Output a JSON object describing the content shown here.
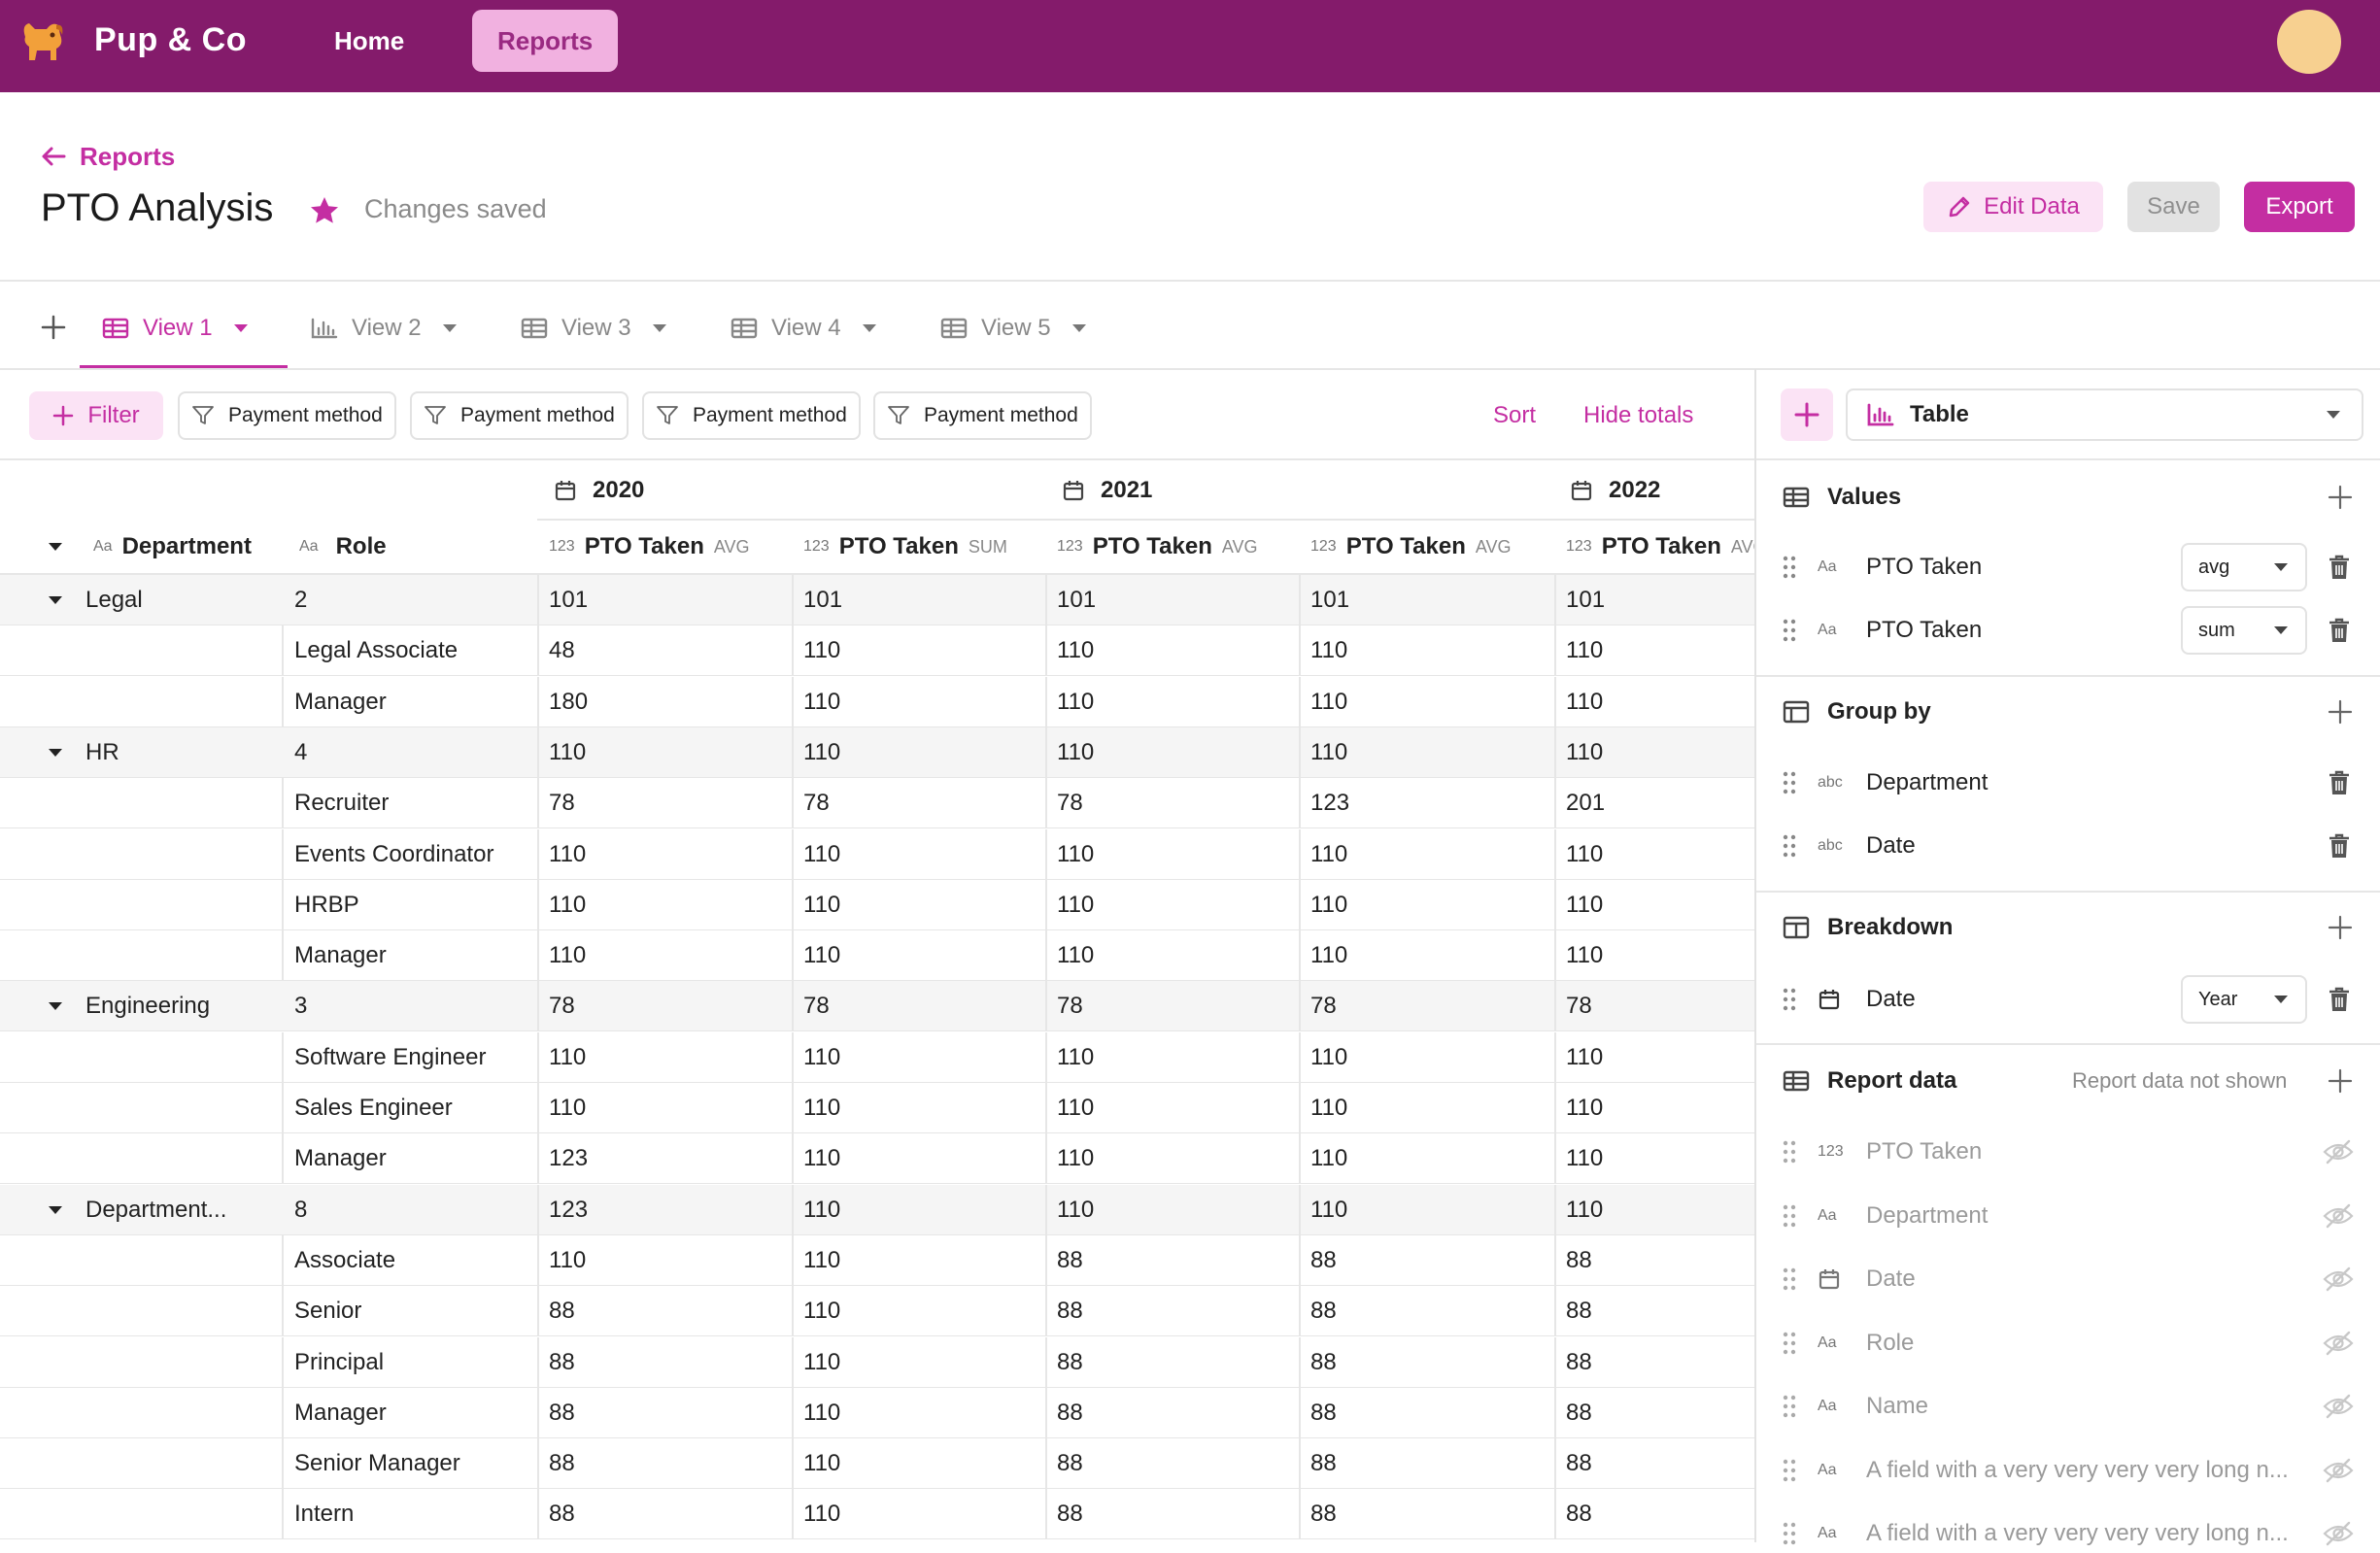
{
  "app": {
    "brand": "Pup & Co",
    "nav": [
      "Home",
      "Reports"
    ],
    "active_nav": "Reports"
  },
  "header": {
    "back_label": "Reports",
    "title": "PTO Analysis",
    "saved_status": "Changes saved",
    "edit_label": "Edit Data",
    "save_label": "Save",
    "export_label": "Export"
  },
  "tabs": [
    {
      "label": "View 1",
      "icon": "table-icon",
      "active": true
    },
    {
      "label": "View 2",
      "icon": "bar-chart-icon",
      "active": false
    },
    {
      "label": "View 3",
      "icon": "table-icon",
      "active": false
    },
    {
      "label": "View 4",
      "icon": "table-icon",
      "active": false
    },
    {
      "label": "View 5",
      "icon": "table-icon",
      "active": false
    }
  ],
  "toolbar": {
    "filter_label": "Filter",
    "chips": [
      "Payment method",
      "Payment method",
      "Payment method",
      "Payment method"
    ],
    "sort_label": "Sort",
    "hide_totals_label": "Hide totals"
  },
  "table": {
    "years": [
      "2020",
      "2021",
      "2022"
    ],
    "row_headers": [
      {
        "type": "Aa",
        "label": "Department"
      },
      {
        "type": "Aa",
        "label": "Role"
      }
    ],
    "value_columns": [
      {
        "type": "123",
        "label": "PTO Taken",
        "agg": "AVG"
      },
      {
        "type": "123",
        "label": "PTO Taken",
        "agg": "SUM"
      },
      {
        "type": "123",
        "label": "PTO Taken",
        "agg": "AVG"
      },
      {
        "type": "123",
        "label": "PTO Taken",
        "agg": "AVG"
      },
      {
        "type": "123",
        "label": "PTO Taken",
        "agg": "AVG"
      }
    ],
    "rows": [
      {
        "group": true,
        "dept": "Legal",
        "role": "2",
        "values": [
          "101",
          "101",
          "101",
          "101",
          "101"
        ]
      },
      {
        "group": false,
        "dept": "",
        "role": "Legal Associate",
        "values": [
          "48",
          "110",
          "110",
          "110",
          "110"
        ]
      },
      {
        "group": false,
        "dept": "",
        "role": "Manager",
        "values": [
          "180",
          "110",
          "110",
          "110",
          "110"
        ]
      },
      {
        "group": true,
        "dept": "HR",
        "role": "4",
        "values": [
          "110",
          "110",
          "110",
          "110",
          "110"
        ]
      },
      {
        "group": false,
        "dept": "",
        "role": "Recruiter",
        "values": [
          "78",
          "78",
          "78",
          "123",
          "201"
        ]
      },
      {
        "group": false,
        "dept": "",
        "role": "Events Coordinator",
        "values": [
          "110",
          "110",
          "110",
          "110",
          "110"
        ]
      },
      {
        "group": false,
        "dept": "",
        "role": "HRBP",
        "values": [
          "110",
          "110",
          "110",
          "110",
          "110"
        ]
      },
      {
        "group": false,
        "dept": "",
        "role": "Manager",
        "values": [
          "110",
          "110",
          "110",
          "110",
          "110"
        ]
      },
      {
        "group": true,
        "dept": "Engineering",
        "role": "3",
        "values": [
          "78",
          "78",
          "78",
          "78",
          "78"
        ]
      },
      {
        "group": false,
        "dept": "",
        "role": "Software Engineer",
        "values": [
          "110",
          "110",
          "110",
          "110",
          "110"
        ]
      },
      {
        "group": false,
        "dept": "",
        "role": "Sales Engineer",
        "values": [
          "110",
          "110",
          "110",
          "110",
          "110"
        ]
      },
      {
        "group": false,
        "dept": "",
        "role": "Manager",
        "values": [
          "123",
          "110",
          "110",
          "110",
          "110"
        ]
      },
      {
        "group": true,
        "dept": "Department...",
        "role": "8",
        "values": [
          "123",
          "110",
          "110",
          "110",
          "110"
        ]
      },
      {
        "group": false,
        "dept": "",
        "role": "Associate",
        "values": [
          "110",
          "110",
          "88",
          "88",
          "88"
        ]
      },
      {
        "group": false,
        "dept": "",
        "role": "Senior",
        "values": [
          "88",
          "110",
          "88",
          "88",
          "88"
        ]
      },
      {
        "group": false,
        "dept": "",
        "role": "Principal",
        "values": [
          "88",
          "110",
          "88",
          "88",
          "88"
        ]
      },
      {
        "group": false,
        "dept": "",
        "role": "Manager",
        "values": [
          "88",
          "110",
          "88",
          "88",
          "88"
        ]
      },
      {
        "group": false,
        "dept": "",
        "role": "Senior Manager",
        "values": [
          "88",
          "110",
          "88",
          "88",
          "88"
        ]
      },
      {
        "group": false,
        "dept": "",
        "role": "Intern",
        "values": [
          "88",
          "110",
          "88",
          "88",
          "88"
        ]
      }
    ]
  },
  "panel": {
    "chart_type": "Table",
    "values": {
      "title": "Values",
      "items": [
        {
          "type": "Aa",
          "label": "PTO Taken",
          "agg": "avg"
        },
        {
          "type": "Aa",
          "label": "PTO Taken",
          "agg": "sum"
        }
      ]
    },
    "group_by": {
      "title": "Group by",
      "items": [
        {
          "type": "abc",
          "label": "Department"
        },
        {
          "type": "abc",
          "label": "Date"
        }
      ]
    },
    "breakdown": {
      "title": "Breakdown",
      "items": [
        {
          "type": "calendar-icon",
          "label": "Date",
          "granularity": "Year"
        }
      ]
    },
    "report_data": {
      "title": "Report data",
      "note": "Report data not shown",
      "items": [
        {
          "type": "123",
          "label": "PTO Taken"
        },
        {
          "type": "Aa",
          "label": "Department"
        },
        {
          "type": "calendar-icon",
          "label": "Date"
        },
        {
          "type": "Aa",
          "label": "Role"
        },
        {
          "type": "Aa",
          "label": "Name"
        },
        {
          "type": "Aa",
          "label": "A field with a very very very very long n..."
        },
        {
          "type": "Aa",
          "label": "A field with a very very very very long n..."
        }
      ]
    }
  },
  "colors": {
    "brand": "#841b6b",
    "accent": "#c42ea2",
    "accent_light": "#fbe3f5",
    "avatar": "#f7d090"
  }
}
